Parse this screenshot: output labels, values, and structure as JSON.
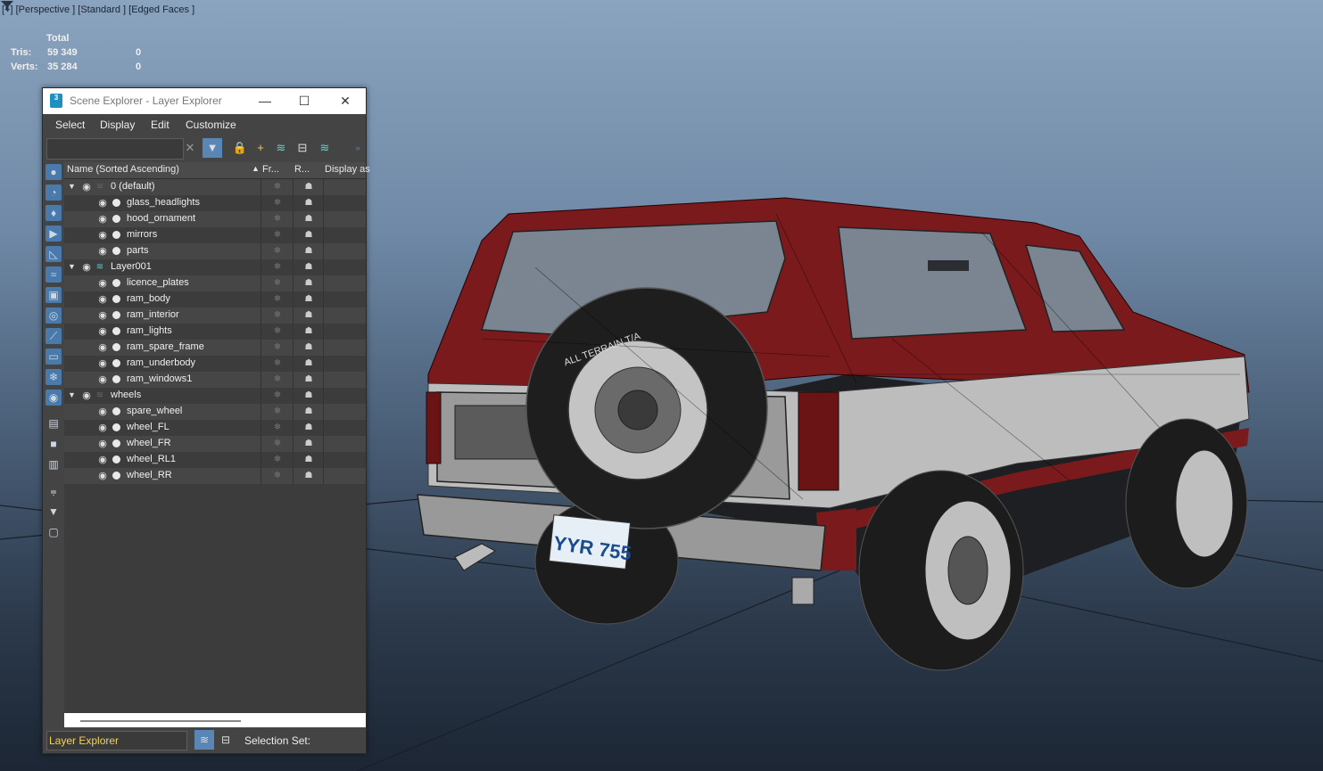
{
  "viewport": {
    "label": "[+] [Perspective ] [Standard ] [Edged Faces ]",
    "stats": {
      "header": "Total",
      "rows": [
        {
          "label": "Tris:",
          "total": "59 349",
          "selected": "0"
        },
        {
          "label": "Verts:",
          "total": "35 284",
          "selected": "0"
        }
      ]
    },
    "license_plate": "YYR 755",
    "tire_text": "ALL TERRAIN T/A"
  },
  "window": {
    "title": "Scene Explorer - Layer Explorer",
    "app_icon_label": "3",
    "buttons": {
      "minimize": "—",
      "maximize": "☐",
      "close": "✕"
    },
    "menu": [
      "Select",
      "Display",
      "Edit",
      "Customize"
    ],
    "search_placeholder": "",
    "columns": {
      "name": "Name (Sorted Ascending)",
      "frozen": "Fr...",
      "render": "R...",
      "display": "Display as"
    },
    "rows": [
      {
        "kind": "layer",
        "name": "0 (default)",
        "depth": 0
      },
      {
        "kind": "object",
        "name": "glass_headlights",
        "depth": 1
      },
      {
        "kind": "object",
        "name": "hood_ornament",
        "depth": 1
      },
      {
        "kind": "object",
        "name": "mirrors",
        "depth": 1
      },
      {
        "kind": "object",
        "name": "parts",
        "depth": 1
      },
      {
        "kind": "layer",
        "name": "Layer001",
        "depth": 0,
        "current": true
      },
      {
        "kind": "object",
        "name": "licence_plates",
        "depth": 1
      },
      {
        "kind": "object",
        "name": "ram_body",
        "depth": 1
      },
      {
        "kind": "object",
        "name": "ram_interior",
        "depth": 1
      },
      {
        "kind": "object",
        "name": "ram_lights",
        "depth": 1
      },
      {
        "kind": "object",
        "name": "ram_spare_frame",
        "depth": 1
      },
      {
        "kind": "object",
        "name": "ram_underbody",
        "depth": 1
      },
      {
        "kind": "object",
        "name": "ram_windows1",
        "depth": 1
      },
      {
        "kind": "layer",
        "name": "wheels",
        "depth": 0
      },
      {
        "kind": "object",
        "name": "spare_wheel",
        "depth": 1
      },
      {
        "kind": "object",
        "name": "wheel_FL",
        "depth": 1
      },
      {
        "kind": "object",
        "name": "wheel_FR",
        "depth": 1
      },
      {
        "kind": "object",
        "name": "wheel_RL1",
        "depth": 1
      },
      {
        "kind": "object",
        "name": "wheel_RR",
        "depth": 1
      }
    ],
    "bottom": {
      "explorer_select": "Layer Explorer",
      "selection_set_label": "Selection Set:"
    }
  },
  "colors": {
    "accent": "#5a86b6",
    "body_red": "#7a1a1c",
    "title_bg": "#ffffff",
    "panel_bg": "#444444",
    "combo_text": "#f5d54a"
  }
}
